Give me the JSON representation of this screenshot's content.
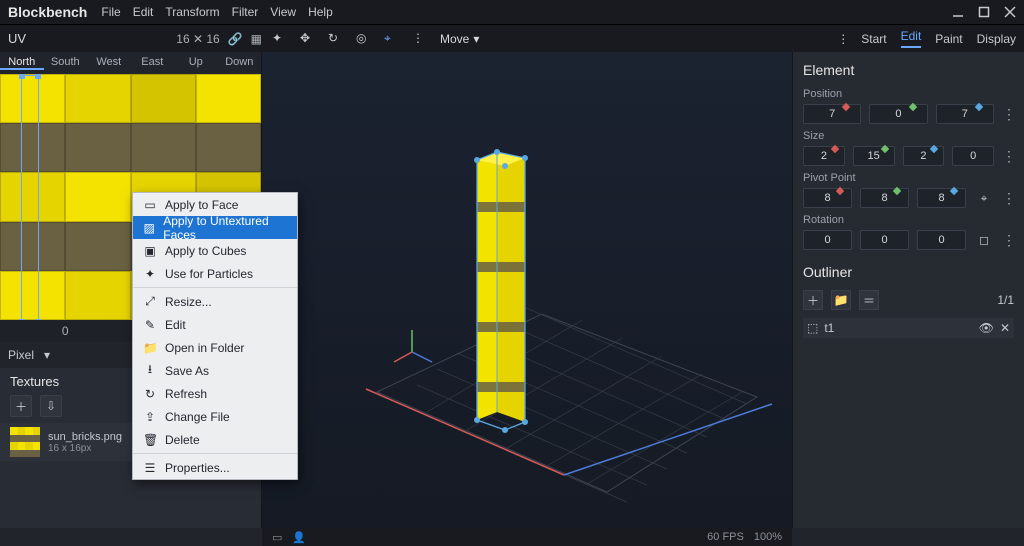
{
  "app": {
    "name": "Blockbench"
  },
  "menu": {
    "items": [
      "File",
      "Edit",
      "Transform",
      "Filter",
      "View",
      "Help"
    ]
  },
  "modebar": {
    "uv_label": "UV",
    "uv_res": "16 ✕ 16",
    "move_label": "Move",
    "modes": [
      "Start",
      "Edit",
      "Paint",
      "Display"
    ],
    "active_mode": "Edit"
  },
  "uv": {
    "faces": [
      "North",
      "South",
      "West",
      "East",
      "Up",
      "Down"
    ],
    "selected_face": "North",
    "coord_x": "0",
    "coord_y": "0",
    "pixel_label": "Pixel"
  },
  "textures": {
    "header": "Textures",
    "file": {
      "name": "sun_bricks.png",
      "dim": "16 x 16px"
    }
  },
  "context_menu": {
    "items": [
      {
        "icon": "▭",
        "label": "Apply to Face"
      },
      {
        "icon": "▨",
        "label": "Apply to Untextured Faces",
        "selected": true
      },
      {
        "icon": "▣",
        "label": "Apply to Cubes"
      },
      {
        "icon": "✦",
        "label": "Use for Particles"
      },
      {
        "sep": true
      },
      {
        "icon": "⤢",
        "label": "Resize..."
      },
      {
        "icon": "✎",
        "label": "Edit"
      },
      {
        "icon": "📁",
        "label": "Open in Folder"
      },
      {
        "icon": "⭳",
        "label": "Save As"
      },
      {
        "icon": "↻",
        "label": "Refresh"
      },
      {
        "icon": "⇪",
        "label": "Change File"
      },
      {
        "icon": "🗑",
        "label": "Delete"
      },
      {
        "sep": true
      },
      {
        "icon": "☰",
        "label": "Properties..."
      }
    ]
  },
  "element": {
    "title": "Element",
    "position": {
      "label": "Position",
      "x": "7",
      "y": "0",
      "z": "7"
    },
    "size": {
      "label": "Size",
      "x": "2",
      "y": "15",
      "z": "2",
      "w": "0"
    },
    "pivot": {
      "label": "Pivot Point",
      "x": "8",
      "y": "8",
      "z": "8"
    },
    "rotation": {
      "label": "Rotation",
      "x": "0",
      "y": "0",
      "z": "0"
    }
  },
  "outliner": {
    "title": "Outliner",
    "count": "1/1",
    "item": "t1"
  },
  "status": {
    "fps": "60 FPS",
    "zoom": "100%"
  }
}
